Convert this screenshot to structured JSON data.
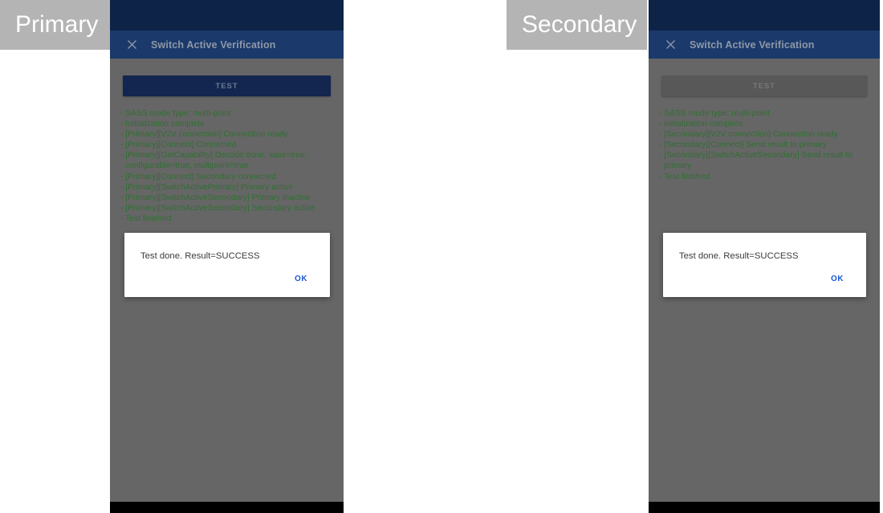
{
  "annotations": {
    "primary": "Primary",
    "secondary": "Secondary"
  },
  "colors": {
    "status_bar": "#0d2347",
    "app_bar": "#1b3a6b",
    "body": "#666666",
    "log_text": "#2f7031",
    "button_enabled": "#12264f",
    "button_disabled": "#585858",
    "dialog_action": "#1756d6",
    "annotation_bg": "#b4b4b4"
  },
  "primary_device": {
    "app_bar": {
      "close_icon": "close-icon",
      "title": "Switch Active Verification"
    },
    "test_button": {
      "label": "TEST",
      "state": "enabled"
    },
    "log_lines": [
      "- SASS mode type: multi-point",
      "- Initialization complete",
      "- [Primary][V2V connection] Connection ready",
      "- [Primary][Connect] Connected",
      "- [Primary][GetCapability] Decode done, sass=true, configurable=true, multipoint=true",
      "- [Primary][Connect] Secondary connected",
      "- [Primary][SwitchActivePrimary] Primary active",
      "- [Primary][SwitchActiveSecondary] Primary inactive",
      "- [Primary][SwitchActiveSecondary] Secondary active",
      "- Test finished"
    ],
    "dialog": {
      "message": "Test done. Result=SUCCESS",
      "ok_label": "OK"
    }
  },
  "secondary_device": {
    "app_bar": {
      "close_icon": "close-icon",
      "title": "Switch Active Verification"
    },
    "test_button": {
      "label": "TEST",
      "state": "disabled"
    },
    "log_lines": [
      "- SASS mode type: multi-point",
      "- Initialization complete",
      "- [Secondary][V2V connection] Connection ready",
      "- [Secondary][Connect] Send result to primary",
      "- [Secondary][SwitchActiveSecondary] Send result to primary",
      "- Test finished"
    ],
    "dialog": {
      "message": "Test done. Result=SUCCESS",
      "ok_label": "OK"
    }
  }
}
